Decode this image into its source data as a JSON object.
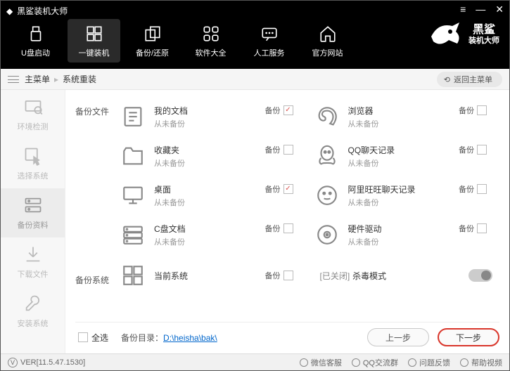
{
  "window": {
    "title": "黑鲨装机大师"
  },
  "brand": {
    "name": "黑鲨",
    "sub": "装机大师"
  },
  "topTabs": [
    {
      "label": "U盘启动"
    },
    {
      "label": "一键装机"
    },
    {
      "label": "备份/还原"
    },
    {
      "label": "软件大全"
    },
    {
      "label": "人工服务"
    },
    {
      "label": "官方网站"
    }
  ],
  "breadcrumb": {
    "root": "主菜单",
    "current": "系统重装",
    "return": "返回主菜单"
  },
  "sideSteps": [
    {
      "label": "环境检测"
    },
    {
      "label": "选择系统"
    },
    {
      "label": "备份资料"
    },
    {
      "label": "下载文件"
    },
    {
      "label": "安装系统"
    }
  ],
  "section": {
    "backupFiles": "备份文件",
    "backupSystem": "备份系统"
  },
  "items": {
    "left": [
      {
        "name": "我的文档",
        "sub": "从未备份",
        "chk": "备份",
        "checked": true
      },
      {
        "name": "收藏夹",
        "sub": "从未备份",
        "chk": "备份",
        "checked": false
      },
      {
        "name": "桌面",
        "sub": "从未备份",
        "chk": "备份",
        "checked": true
      },
      {
        "name": "C盘文档",
        "sub": "从未备份",
        "chk": "备份",
        "checked": false
      }
    ],
    "right": [
      {
        "name": "浏览器",
        "sub": "从未备份",
        "chk": "备份",
        "checked": false
      },
      {
        "name": "QQ聊天记录",
        "sub": "从未备份",
        "chk": "备份",
        "checked": false
      },
      {
        "name": "阿里旺旺聊天记录",
        "sub": "从未备份",
        "chk": "备份",
        "checked": false
      },
      {
        "name": "硬件驱动",
        "sub": "从未备份",
        "chk": "备份",
        "checked": false
      }
    ]
  },
  "system": {
    "name": "当前系统",
    "chk": "备份",
    "killOff": "[已关闭]",
    "killText": " 杀毒模式"
  },
  "bottom": {
    "selectAll": "全选",
    "backupDirLabel": "备份目录：",
    "backupDirPath": "D:\\heisha\\bak\\",
    "prev": "上一步",
    "next": "下一步"
  },
  "status": {
    "ver": "VER[11.5.47.1530]",
    "links": [
      "微信客服",
      "QQ交流群",
      "问题反馈",
      "帮助视频"
    ]
  }
}
